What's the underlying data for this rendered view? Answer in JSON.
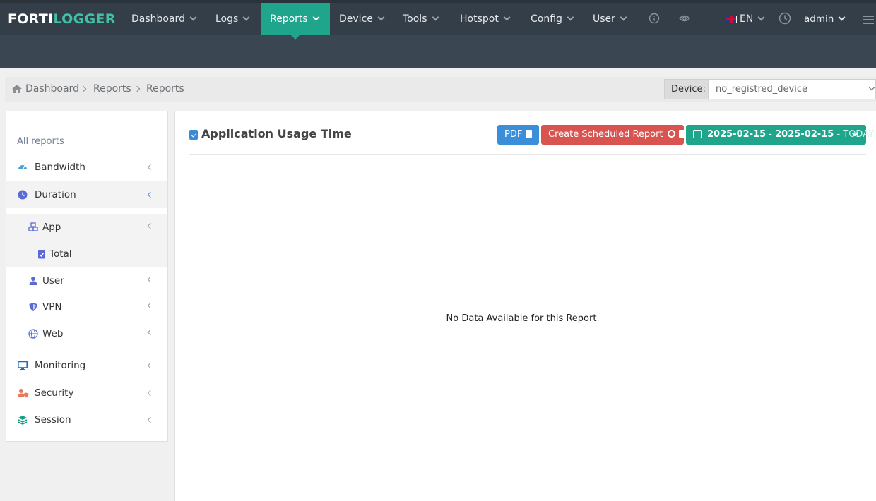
{
  "brand": {
    "part1": "FORTI",
    "part2": "LOGGER"
  },
  "nav": {
    "items": [
      {
        "label": "Dashboard"
      },
      {
        "label": "Logs"
      },
      {
        "label": "Reports"
      },
      {
        "label": "Device"
      },
      {
        "label": "Tools"
      },
      {
        "label": "Hotspot"
      },
      {
        "label": "Config"
      },
      {
        "label": "User"
      }
    ],
    "active": "Reports",
    "language": "EN",
    "user": "admin",
    "icons": [
      "info-icon",
      "eye-icon",
      "flag-uk-icon",
      "clock-icon",
      "hamburger-icon"
    ]
  },
  "breadcrumb": {
    "items": [
      "Dashboard",
      "Reports",
      "Reports"
    ],
    "device_label": "Device:",
    "device_value": "no_registred_device"
  },
  "sidebar": {
    "header": "All reports",
    "items": [
      {
        "label": "Bandwidth",
        "icon": "gauge-icon"
      },
      {
        "label": "Duration",
        "icon": "clock-icon"
      },
      {
        "label": "App",
        "icon": "cubes-icon"
      },
      {
        "label": "Total",
        "icon": "clipboard-check-icon"
      },
      {
        "label": "User",
        "icon": "user-icon"
      },
      {
        "label": "VPN",
        "icon": "shield-icon"
      },
      {
        "label": "Web",
        "icon": "globe-icon"
      },
      {
        "label": "Monitoring",
        "icon": "monitor-icon"
      },
      {
        "label": "Security",
        "icon": "user-shield-icon"
      },
      {
        "label": "Session",
        "icon": "layers-icon"
      }
    ]
  },
  "panel": {
    "title": "Application Usage Time",
    "pdf_label": "PDF",
    "scheduled_label": "Create Scheduled Report",
    "date_from": "2025-02-15",
    "date_sep": "-",
    "date_to": "2025-02-15",
    "date_suffix": "- TODAY",
    "empty_message": "No Data Available for this Report"
  },
  "colors": {
    "nav_bg": "#343e48",
    "active_teal": "#1fa58c",
    "pdf_blue": "#3a8fd8",
    "scheduled_red": "#d9534f",
    "brand_green": "#3fc1a8"
  }
}
